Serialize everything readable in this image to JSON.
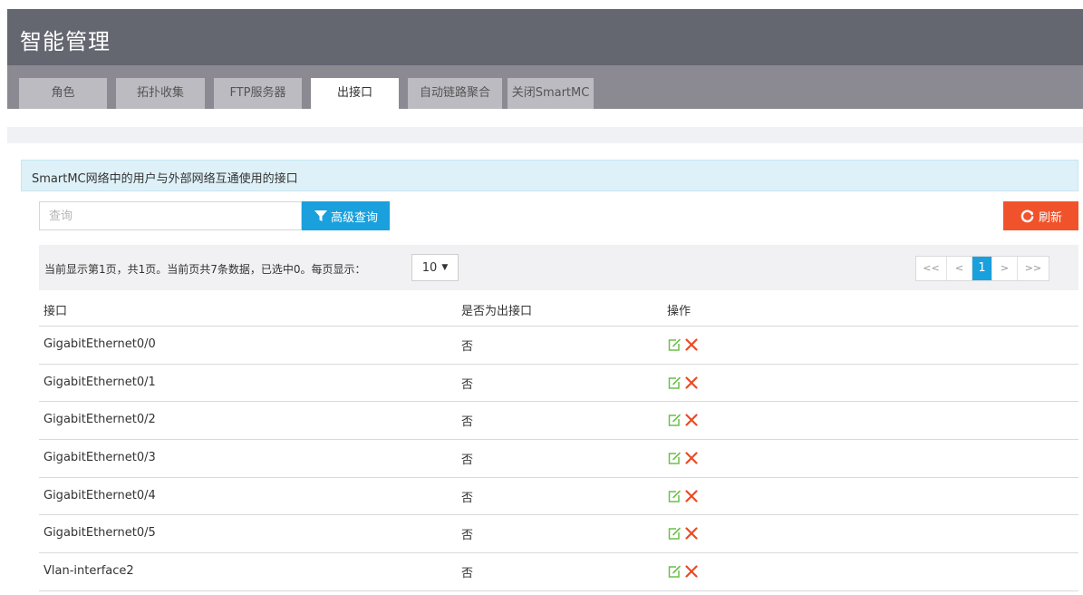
{
  "header": {
    "title": "智能管理"
  },
  "tabs": [
    {
      "label": "角色"
    },
    {
      "label": "拓扑收集"
    },
    {
      "label": "FTP服务器"
    },
    {
      "label": "出接口"
    },
    {
      "label": "自动链路聚合"
    },
    {
      "label": "关闭SmartMC"
    }
  ],
  "active_tab": 3,
  "info": {
    "text": "SmartMC网络中的用户与外部网络互通使用的接口"
  },
  "toolbar": {
    "search_placeholder": "查询",
    "search_value": "",
    "advanced_label": "高级查询",
    "refresh_label": "刷新"
  },
  "pagination": {
    "info": "当前显示第1页，共1页。当前页共7条数据，已选中0。每页显示：",
    "per_page": "10",
    "first": "<<",
    "prev": "<",
    "current": "1",
    "next": ">",
    "last": ">>"
  },
  "table": {
    "columns": [
      "接口",
      "是否为出接口",
      "操作"
    ],
    "rows": [
      {
        "interface": "GigabitEthernet0/0",
        "is_out": "否"
      },
      {
        "interface": "GigabitEthernet0/1",
        "is_out": "否"
      },
      {
        "interface": "GigabitEthernet0/2",
        "is_out": "否"
      },
      {
        "interface": "GigabitEthernet0/3",
        "is_out": "否"
      },
      {
        "interface": "GigabitEthernet0/4",
        "is_out": "否"
      },
      {
        "interface": "GigabitEthernet0/5",
        "is_out": "否"
      },
      {
        "interface": "Vlan-interface2",
        "is_out": "否"
      }
    ]
  },
  "colors": {
    "header_bg": "#646670",
    "tabbar_bg": "#8b8a92",
    "accent_blue": "#1aa0dc",
    "refresh_red": "#f0532c",
    "edit_green": "#6cc04a",
    "delete_red": "#ec4a22"
  },
  "icons": {
    "filter": "filter-icon",
    "refresh": "refresh-icon",
    "edit": "edit-icon",
    "delete": "delete-icon",
    "dropdown": "caret-down-icon"
  }
}
